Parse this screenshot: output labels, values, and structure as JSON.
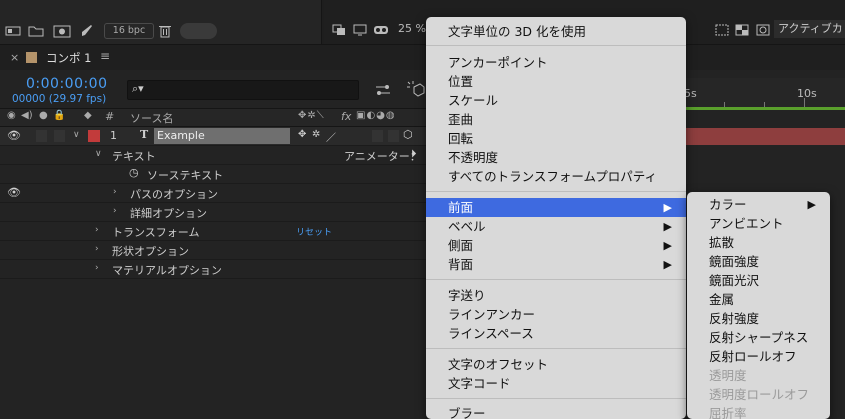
{
  "toolbar": {
    "bpc": "16 bpc",
    "zoom": "25 %",
    "view_dropdown": "アクティブカ"
  },
  "panel": {
    "close": "×",
    "tab_name": "コンポ 1",
    "menu_glyph": "≡"
  },
  "timeline": {
    "timecode": "0:00:00:00",
    "frames": "00000 (29.97 fps)",
    "search_glyph": "⌕▾",
    "ruler_labels": [
      "5s",
      "10s"
    ]
  },
  "columns": {
    "hash": "#",
    "source_name": "ソース名",
    "fx": "fx"
  },
  "layer": {
    "number": "1",
    "type_glyph": "T",
    "name": "Example",
    "color": "#c23b3b"
  },
  "properties": {
    "text": "テキスト",
    "animator_label": "アニメーター：",
    "source_text": "ソーステキスト",
    "path_options": "パスのオプション",
    "more_options": "詳細オプション",
    "transform": "トランスフォーム",
    "reset": "リセット",
    "geometry_options": "形状オプション",
    "material_options": "マテリアルオプション"
  },
  "context_menu": {
    "items": [
      "文字単位の 3D 化を使用",
      "アンカーポイント",
      "位置",
      "スケール",
      "歪曲",
      "回転",
      "不透明度",
      "すべてのトランスフォームプロパティ",
      "前面",
      "ベベル",
      "側面",
      "背面",
      "字送り",
      "ラインアンカー",
      "ラインスペース",
      "文字のオフセット",
      "文字コード",
      "ブラー"
    ],
    "submenu_arrow": "▶"
  },
  "submenu": {
    "items": [
      "カラー",
      "アンビエント",
      "拡散",
      "鏡面強度",
      "鏡面光沢",
      "金属",
      "反射強度",
      "反射シャープネス",
      "反射ロールオフ",
      "透明度",
      "透明度ロールオフ",
      "屈折率"
    ]
  },
  "colors": {
    "accent_blue": "#3e6ae0",
    "timecode_blue": "#4a9ef5",
    "layer_red": "#c23b3b",
    "menu_bg": "#d9d9d9"
  }
}
